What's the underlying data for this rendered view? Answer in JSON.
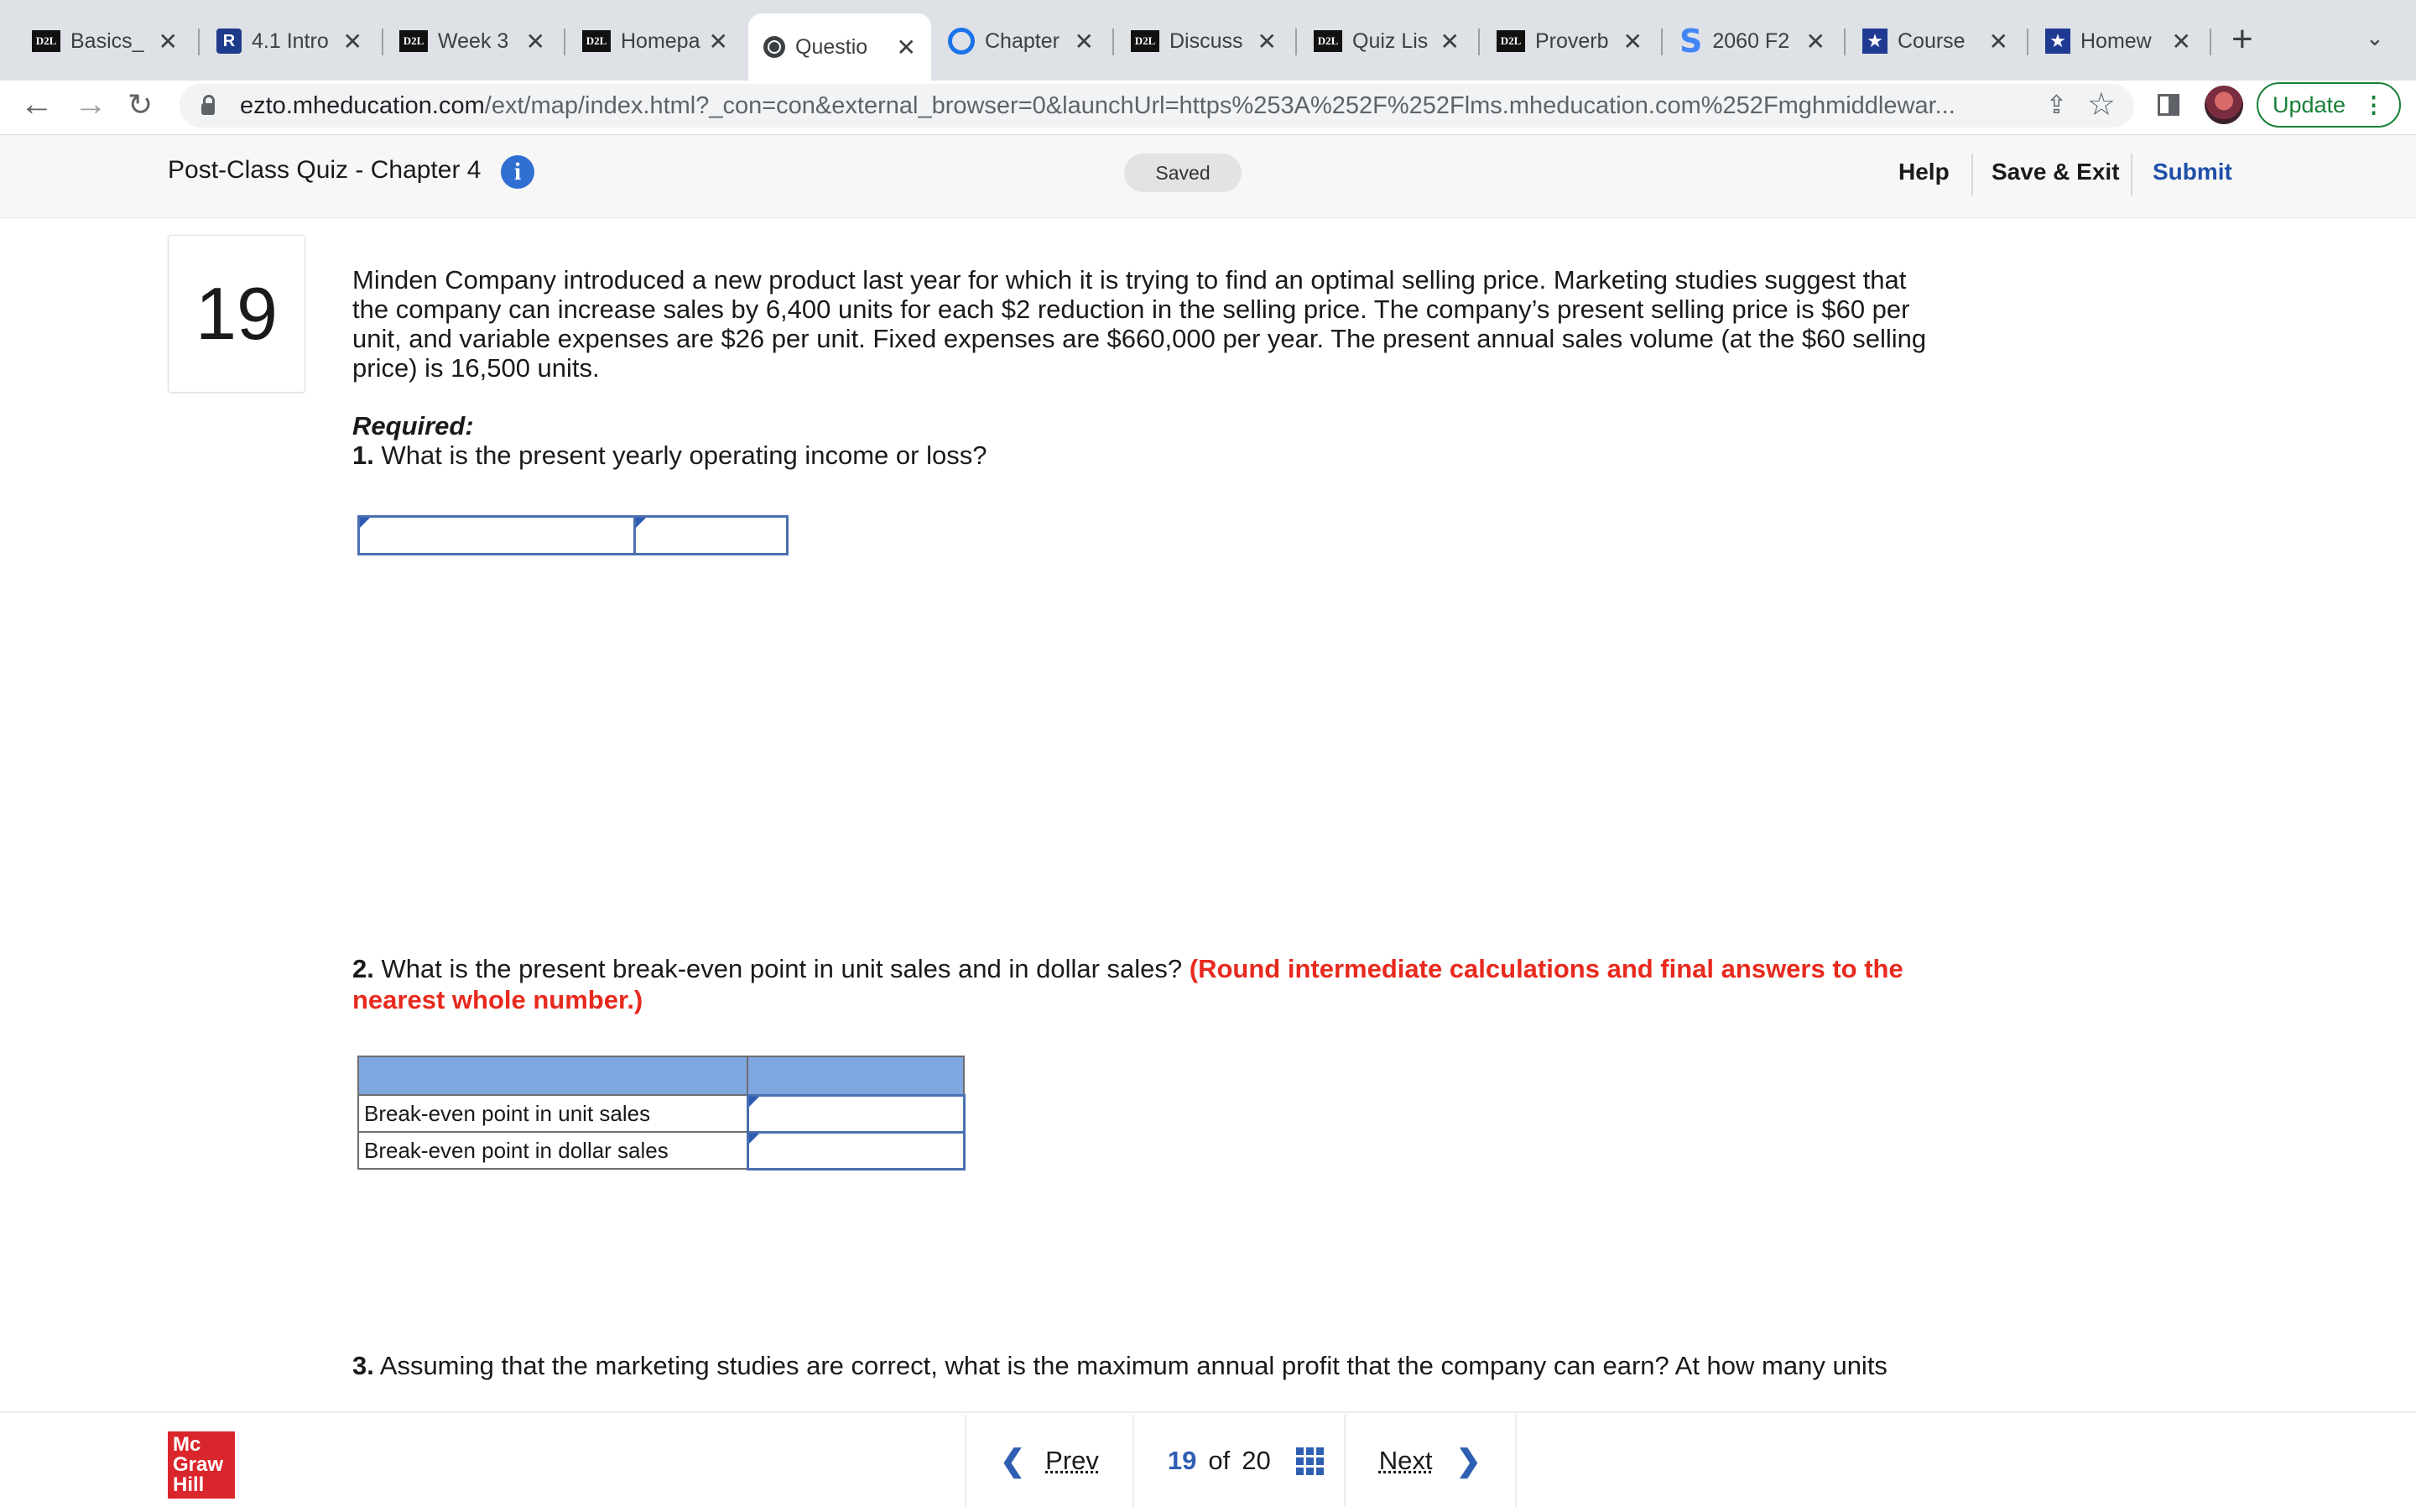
{
  "browser": {
    "tabs": [
      {
        "title": "Basics_",
        "favicon": "d2l-icon",
        "active": false
      },
      {
        "title": "4.1 Intro",
        "favicon": "book-icon",
        "active": false
      },
      {
        "title": "Week 3",
        "favicon": "d2l-icon",
        "active": false
      },
      {
        "title": "Homepa",
        "favicon": "d2l-icon",
        "active": false
      },
      {
        "title": "Questio",
        "favicon": "globe-icon",
        "active": true
      },
      {
        "title": "Chapter",
        "favicon": "search-icon",
        "active": false
      },
      {
        "title": "Discuss",
        "favicon": "d2l-icon",
        "active": false
      },
      {
        "title": "Quiz Lis",
        "favicon": "d2l-icon",
        "active": false
      },
      {
        "title": "Proverb",
        "favicon": "d2l-icon",
        "active": false
      },
      {
        "title": "2060 F2",
        "favicon": "s-icon",
        "active": false
      },
      {
        "title": "Course",
        "favicon": "star-icon",
        "active": false
      },
      {
        "title": "Homew",
        "favicon": "star-icon",
        "active": false
      }
    ],
    "url_host": "ezto.mheducation.com",
    "url_path": "/ext/map/index.html?_con=con&external_browser=0&launchUrl=https%253A%252F%252Flms.mheducation.com%252Fmghmiddlewar...",
    "update_label": "Update"
  },
  "quiz": {
    "title": "Post-Class Quiz - Chapter 4",
    "saved_label": "Saved",
    "help_label": "Help",
    "save_exit_label": "Save & Exit",
    "submit_label": "Submit"
  },
  "question": {
    "number": "19",
    "text": "Minden Company introduced a new product last year for which it is trying to find an optimal selling price. Marketing studies suggest that the company can increase sales by 6,400 units for each $2 reduction in the selling price. The company’s present selling price is $60 per unit, and variable expenses are $26 per unit. Fixed expenses are $660,000 per year. The present annual sales volume (at the $60 selling price) is 16,500 units.",
    "required_label": "Required:",
    "part1_num": "1.",
    "part1_text": "What is the present yearly operating income or loss?",
    "part2_num": "2.",
    "part2_text": "What is the present break-even point in unit sales and in dollar sales?",
    "part2_note": "(Round intermediate calculations and final answers to the nearest whole number.)",
    "part2_rows": [
      "Break-even point in unit sales",
      "Break-even point in dollar sales"
    ],
    "part3_num": "3.",
    "part3_text": "Assuming that the marketing studies are correct, what is the maximum annual profit that the company can earn? At how many units"
  },
  "footer": {
    "logo_text": "Mc Graw Hill",
    "prev_label": "Prev",
    "current_page": "19",
    "of_label": "of",
    "total_pages": "20",
    "next_label": "Next"
  },
  "colors": {
    "accent": "#2f5fb3",
    "note_red": "#e8291d",
    "table_header": "#7fa8e0",
    "brand_red": "#d9262c"
  }
}
